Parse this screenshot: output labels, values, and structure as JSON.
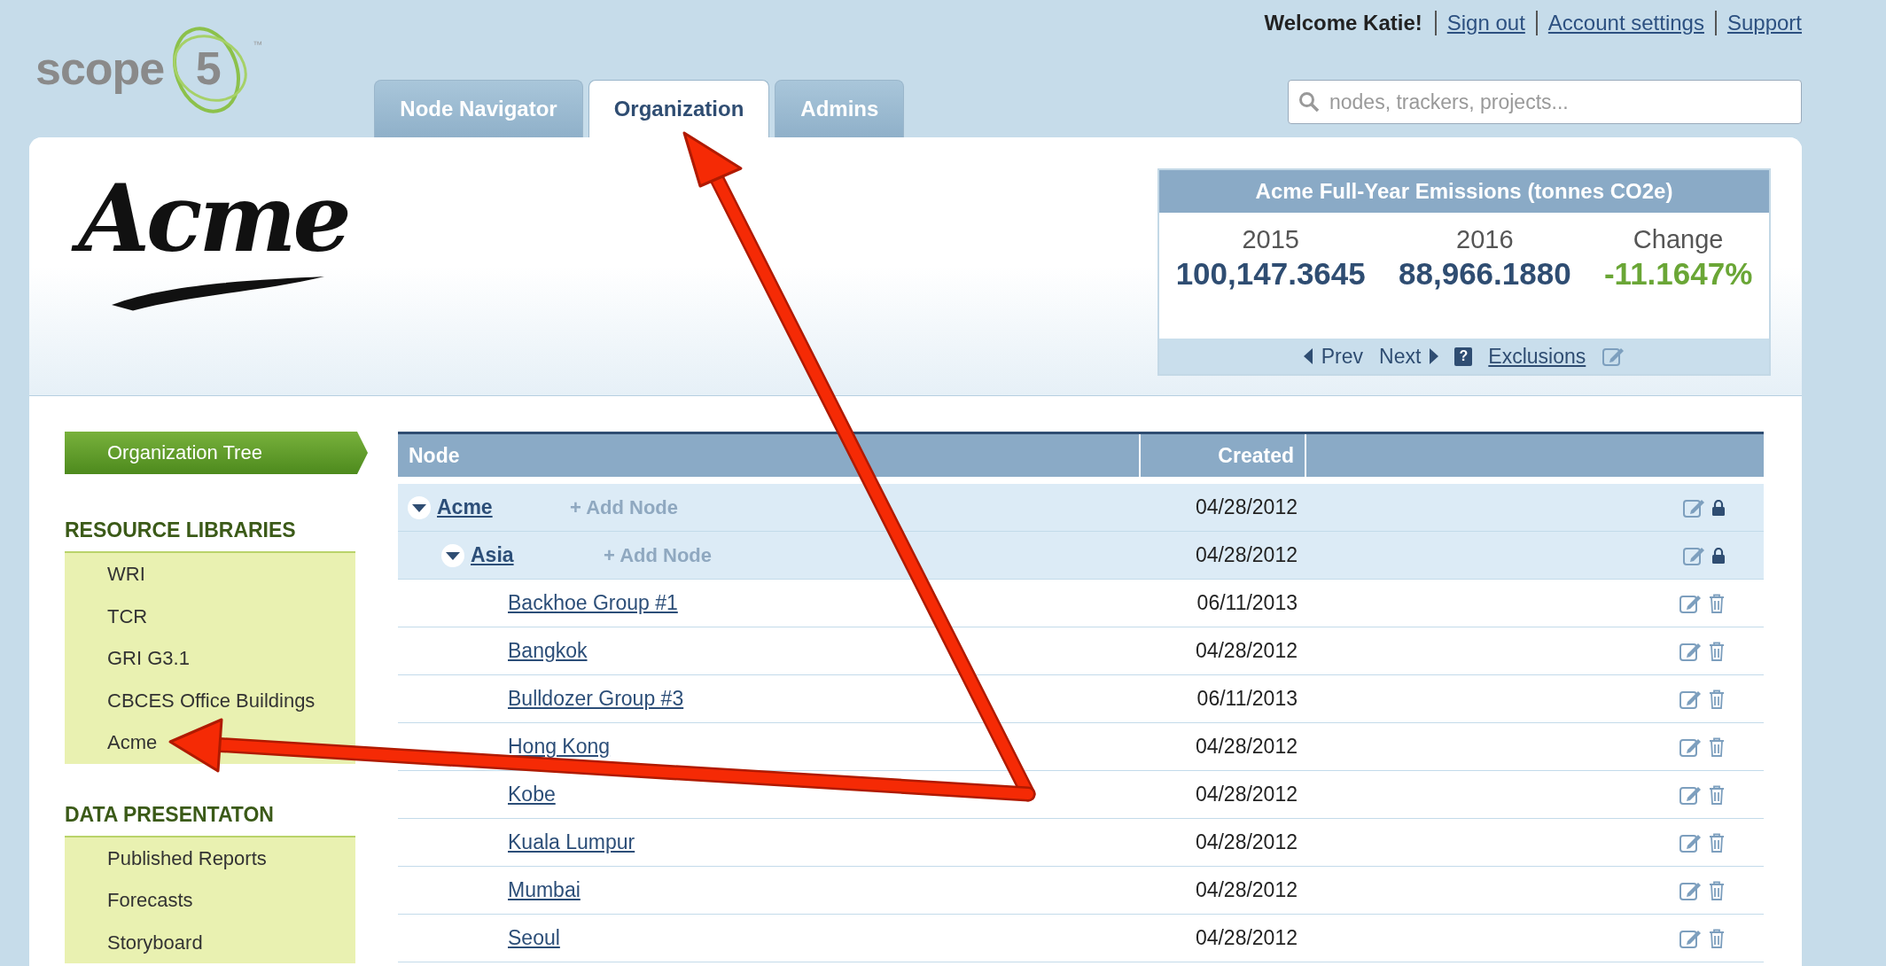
{
  "logo": {
    "text": "scope",
    "number": "5",
    "mark": "™"
  },
  "user_links": {
    "welcome": "Welcome Katie!",
    "links": [
      "Sign out",
      "Account settings",
      "Support"
    ]
  },
  "tabs": [
    {
      "label": "Node Navigator",
      "selected": false
    },
    {
      "label": "Organization",
      "selected": true
    },
    {
      "label": "Admins",
      "selected": false
    }
  ],
  "search": {
    "placeholder": "nodes, trackers, projects..."
  },
  "company_logo": "Acme",
  "emissions": {
    "title": "Acme Full-Year Emissions (tonnes CO2e)",
    "columns": [
      {
        "label": "2015",
        "value": "100,147.3645",
        "kind": "amount"
      },
      {
        "label": "2016",
        "value": "88,966.1880",
        "kind": "amount"
      },
      {
        "label": "Change",
        "value": "-11.1647%",
        "kind": "change"
      }
    ],
    "prev": "Prev",
    "next": "Next",
    "help": "?",
    "exclusions": "Exclusions"
  },
  "sidebar": {
    "active_item": "Organization Tree",
    "sections": [
      {
        "heading": "RESOURCE LIBRARIES",
        "items": [
          "WRI",
          "TCR",
          "GRI G3.1",
          "CBCES Office Buildings",
          "Acme"
        ]
      },
      {
        "heading": "DATA PRESENTATON",
        "items": [
          "Published Reports",
          "Forecasts",
          "Storyboard"
        ]
      }
    ]
  },
  "table": {
    "columns": [
      "Node",
      "Created"
    ],
    "rows": [
      {
        "name": "Acme",
        "created": "04/28/2012",
        "add_label": "+ Add Node",
        "expanded": true,
        "locked": true,
        "children": [
          {
            "name": "Asia",
            "created": "04/28/2012",
            "add_label": "+ Add Node",
            "expanded": true,
            "locked": true,
            "children": [
              {
                "name": "Backhoe Group #1",
                "created": "06/11/2013",
                "locked": false
              },
              {
                "name": "Bangkok",
                "created": "04/28/2012",
                "locked": false
              },
              {
                "name": "Bulldozer Group #3",
                "created": "06/11/2013",
                "locked": false
              },
              {
                "name": "Hong Kong",
                "created": "04/28/2012",
                "locked": false
              },
              {
                "name": "Kobe",
                "created": "04/28/2012",
                "locked": false
              },
              {
                "name": "Kuala Lumpur",
                "created": "04/28/2012",
                "locked": false
              },
              {
                "name": "Mumbai",
                "created": "04/28/2012",
                "locked": false
              },
              {
                "name": "Seoul",
                "created": "04/28/2012",
                "locked": false
              }
            ]
          }
        ]
      }
    ]
  }
}
